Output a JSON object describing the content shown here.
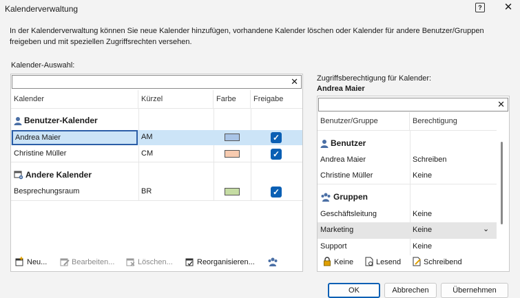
{
  "window": {
    "title": "Kalenderverwaltung",
    "help": "?",
    "close": "✕"
  },
  "description": "In der Kalenderverwaltung können Sie neue Kalender hinzufügen, vorhandene Kalender löschen oder Kalender für andere Benutzer/Gruppen freigeben und mit speziellen Zugriffsrechten versehen.",
  "left": {
    "label": "Kalender-Auswahl:",
    "search": {
      "value": "",
      "clear": "✕"
    },
    "columns": [
      "Kalender",
      "Kürzel",
      "Farbe",
      "Freigabe"
    ],
    "groups": [
      {
        "name": "Benutzer-Kalender",
        "icon": "user-icon",
        "rows": [
          {
            "name": "Andrea Maier",
            "short": "AM",
            "color": "#a9c4e6",
            "shared": true,
            "selected": true
          },
          {
            "name": "Christine Müller",
            "short": "CM",
            "color": "#f7cbb0",
            "shared": true,
            "selected": false
          }
        ]
      },
      {
        "name": "Andere Kalender",
        "icon": "calendar-gear-icon",
        "rows": [
          {
            "name": "Besprechungsraum",
            "short": "BR",
            "color": "#c5dca3",
            "shared": true,
            "selected": false
          }
        ]
      }
    ],
    "toolbar": [
      "Neu...",
      "Bearbeiten...",
      "Löschen...",
      "Reorganisieren...",
      ""
    ]
  },
  "right": {
    "label": "Zugriffsberechtigung für Kalender:",
    "calendar": "Andrea Maier",
    "search": {
      "value": "",
      "clear": "✕"
    },
    "columns": [
      "Benutzer/Gruppe",
      "Berechtigung"
    ],
    "groups": [
      {
        "name": "Benutzer",
        "icon": "user-icon",
        "rows": [
          {
            "name": "Andrea Maier",
            "perm": "Schreiben"
          },
          {
            "name": "Christine Müller",
            "perm": "Keine"
          }
        ]
      },
      {
        "name": "Gruppen",
        "icon": "group-icon",
        "rows": [
          {
            "name": "Geschäftsleitung",
            "perm": "Keine"
          },
          {
            "name": "Marketing",
            "perm": "Keine",
            "highlighted": true
          },
          {
            "name": "Support",
            "perm": "Keine"
          }
        ]
      }
    ],
    "toolbar": [
      "Keine",
      "Lesend",
      "Schreibend"
    ]
  },
  "buttons": {
    "ok": "OK",
    "cancel": "Abbrechen",
    "apply": "Übernehmen"
  },
  "colors": {
    "accent": "#0a5fb4",
    "selection": "#cce4f7"
  }
}
